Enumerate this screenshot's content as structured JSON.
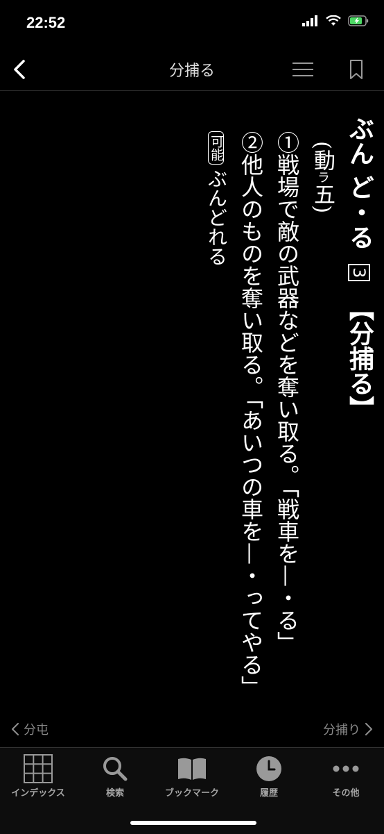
{
  "status_bar": {
    "time": "22:52"
  },
  "nav": {
    "title": "分捕る"
  },
  "entry": {
    "headword_kana": "ぶん ど・る",
    "accent": "3",
    "kanji": "【分捕る】",
    "pos_open": "(動",
    "pos_small": "ラ",
    "pos_close": "五)",
    "sense1": "①戦場で敵の武器などを奪い取る。「戦車を—・る」",
    "sense2": "②他人のものを奪い取る。「あいつの車を—・ってやる」",
    "possible_label": "可能",
    "possible_form": "ぶんどれる"
  },
  "pager": {
    "prev": "分屯",
    "next": "分捕り"
  },
  "tabs": [
    {
      "label": "インデックス",
      "icon": "grid-icon"
    },
    {
      "label": "検索",
      "icon": "search-icon"
    },
    {
      "label": "ブックマーク",
      "icon": "book-icon"
    },
    {
      "label": "履歴",
      "icon": "clock-icon"
    },
    {
      "label": "その他",
      "icon": "more-icon"
    }
  ],
  "colors": {
    "background": "#000000",
    "text": "#ffffff",
    "muted": "#8a8a8a",
    "battery": "#4cd964"
  }
}
